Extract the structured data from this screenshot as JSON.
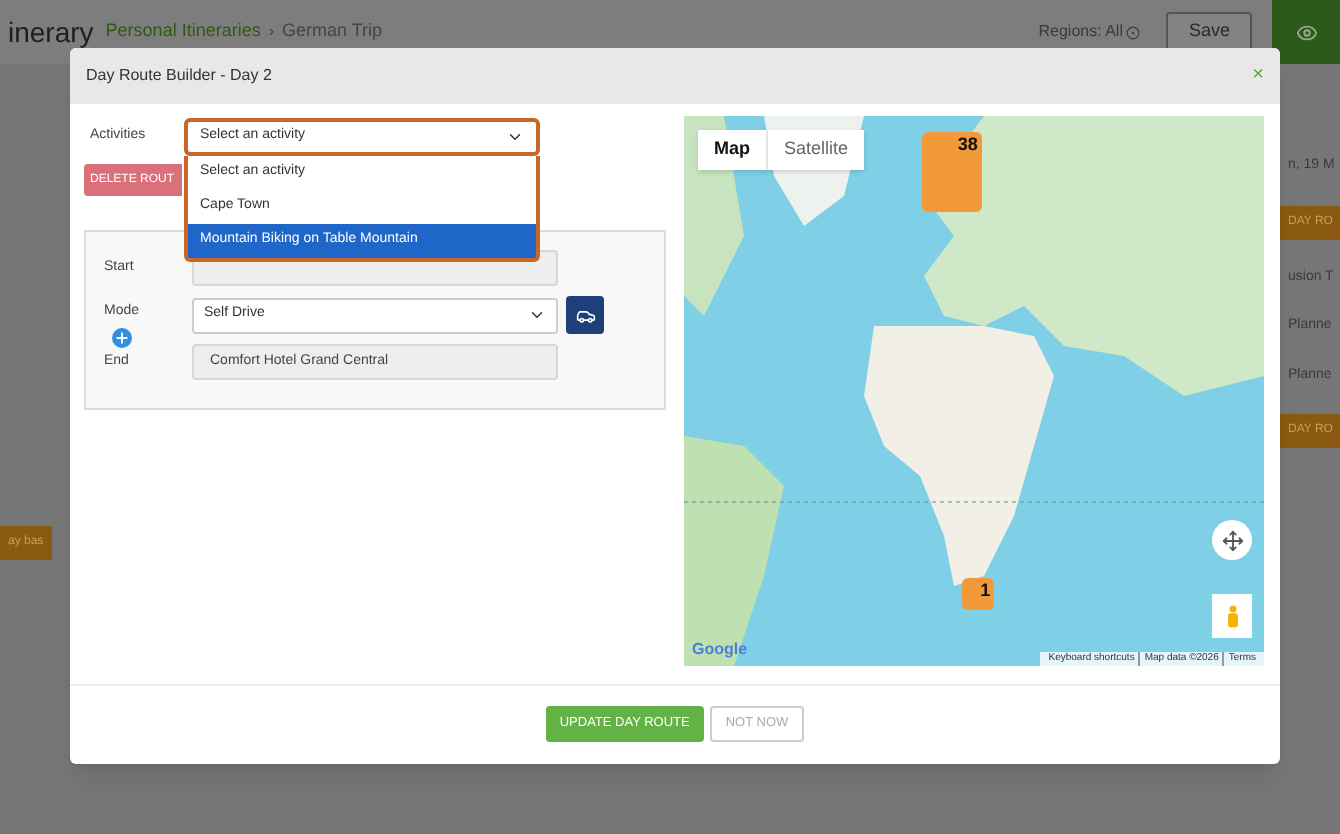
{
  "background": {
    "title": "inerary",
    "breadcrumbs": [
      "Personal Itineraries",
      "German Trip"
    ],
    "breadcrumb_separator": "›",
    "regions_label": "Regions: All",
    "save_button": "Save",
    "left_strip": [
      {
        "kind": "badge",
        "text": "ay bas"
      }
    ],
    "right_strip": [
      {
        "kind": "text",
        "text": "n, 19 M"
      },
      {
        "kind": "badge",
        "text": "DAY RO"
      },
      {
        "kind": "text",
        "text": "usion T"
      },
      {
        "kind": "text",
        "text": "Planne"
      },
      {
        "kind": "text",
        "text": "Planne"
      },
      {
        "kind": "badge",
        "text": "DAY RO"
      }
    ]
  },
  "dialog": {
    "title": "Day Route Builder - Day 2",
    "close": "×",
    "activities": {
      "label": "Activities",
      "value": "Select an activity",
      "expanded": true,
      "options": [
        {
          "label": "Select an activity",
          "highlighted": false
        },
        {
          "label": "Cape Town",
          "highlighted": false
        },
        {
          "label": "Mountain Biking on Table Mountain",
          "highlighted": true
        }
      ]
    },
    "delete_button": "DELETE ROUT",
    "route": {
      "start_label": "Start",
      "mode_label": "Mode",
      "mode_value": "Self Drive",
      "end_label": "End",
      "end_value": "Comfort Hotel Grand Central"
    },
    "map": {
      "map_types": [
        {
          "label": "Map",
          "selected": true
        },
        {
          "label": "Satellite",
          "selected": false
        }
      ],
      "clusters": [
        {
          "count": "38"
        },
        {
          "count": "1"
        }
      ],
      "logo": "Google",
      "attribution": [
        "Keyboard shortcuts",
        "Map data ©2026",
        "Terms"
      ]
    },
    "buttons": [
      {
        "label": "UPDATE DAY ROUTE",
        "kind": "primary"
      },
      {
        "label": "NOT NOW",
        "kind": "secondary"
      }
    ]
  }
}
